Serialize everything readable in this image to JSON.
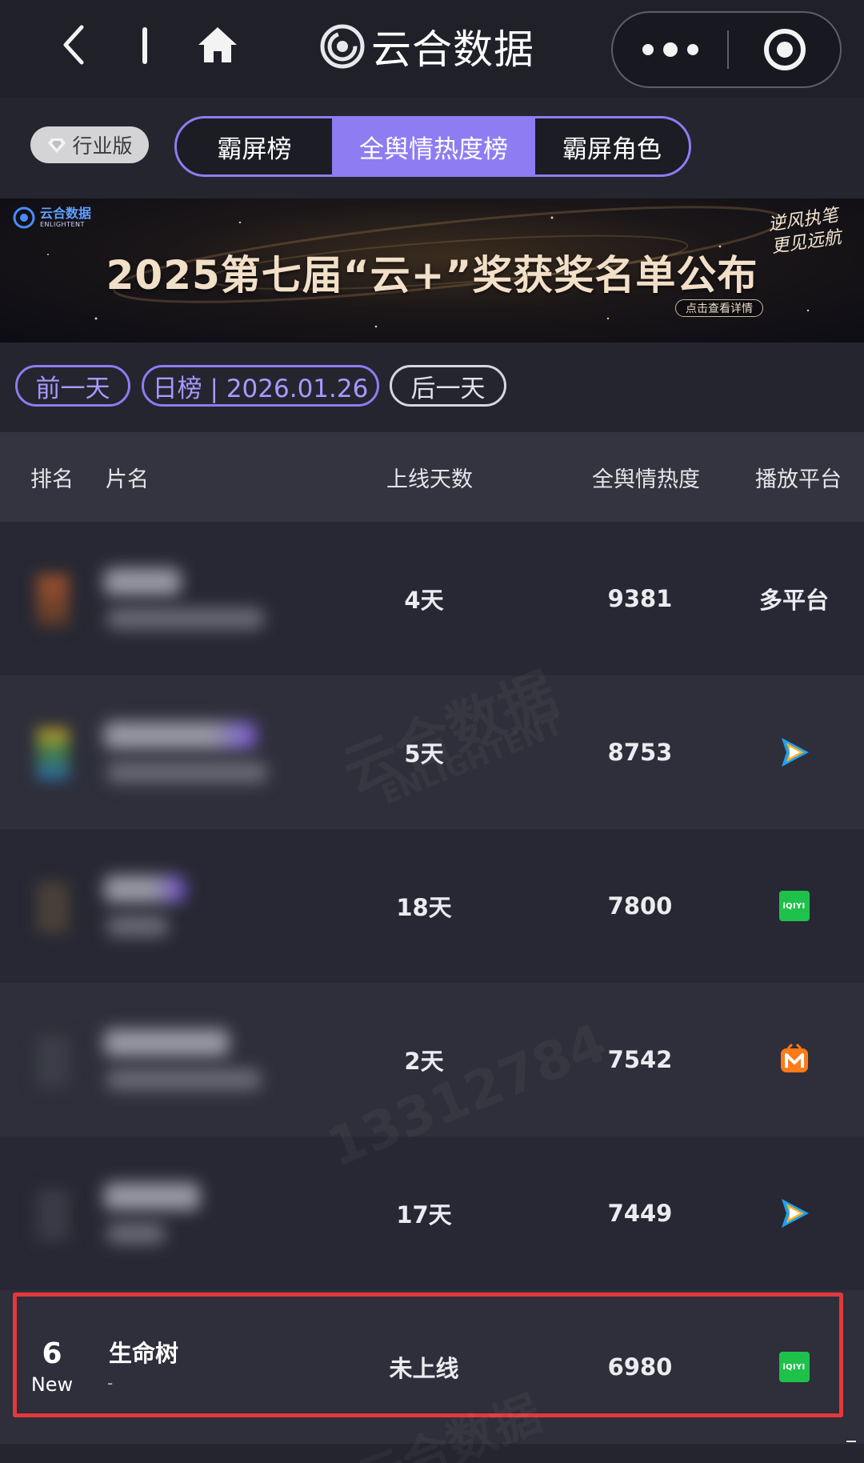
{
  "nav": {
    "title": "云合数据"
  },
  "edition_badge": "行业版",
  "tabs": [
    {
      "label": "霸屏榜",
      "active": false
    },
    {
      "label": "全舆情热度榜",
      "active": true
    },
    {
      "label": "霸屏角色",
      "active": false
    }
  ],
  "banner": {
    "brand_cn": "云合数据",
    "brand_en": "ENLIGHTENT",
    "headline": "2025第七届“云+”奖获奖名单公布",
    "slogan": "逆风执笔 更见远航",
    "cta": "点击查看详情"
  },
  "date_nav": {
    "prev": "前一天",
    "current": "日榜 | 2026.01.26",
    "next": "后一天"
  },
  "table": {
    "headers": {
      "rank": "排名",
      "title": "片名",
      "days": "上线天数",
      "heat": "全舆情热度",
      "platform": "播放平台"
    },
    "rows": [
      {
        "days": "4天",
        "heat": "9381",
        "platform_text": "多平台",
        "platform_icon": "multi-platform"
      },
      {
        "days": "5天",
        "heat": "8753",
        "platform_icon": "tencent-video-icon"
      },
      {
        "days": "18天",
        "heat": "7800",
        "platform_icon": "iqiyi-icon"
      },
      {
        "days": "2天",
        "heat": "7542",
        "platform_icon": "mango-tv-icon"
      },
      {
        "days": "17天",
        "heat": "7449",
        "platform_icon": "tencent-video-icon"
      },
      {
        "rank": "6",
        "rank_badge": "New",
        "title": "生命树",
        "subtitle": "-",
        "days": "未上线",
        "heat": "6980",
        "platform_icon": "iqiyi-icon"
      }
    ],
    "iqiyi_label": "iQIYI"
  },
  "watermark": {
    "brand_cn": "云合数据",
    "brand_en": "ENLIGHTENT",
    "id": "13312784"
  },
  "colors": {
    "accent": "#8e7cf2",
    "highlight_border": "#e4383c",
    "background": "#24252f",
    "iqiyi_green": "#1ec24a"
  }
}
